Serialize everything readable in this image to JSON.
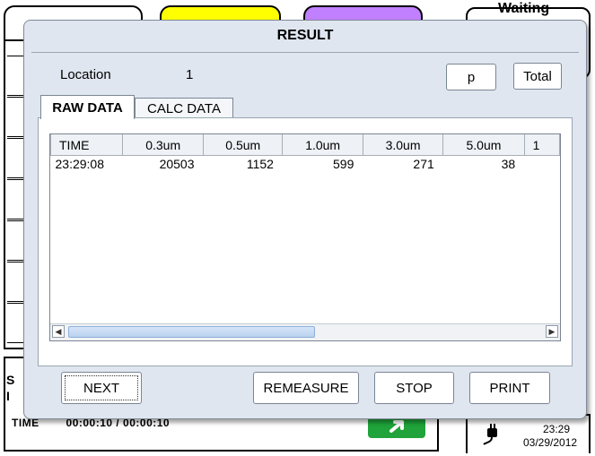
{
  "background": {
    "status_time_label": "TIME",
    "status_time_value": "00:00:10 / 00:00:10",
    "status_letter_top": "S",
    "status_letter_bottom": "I",
    "clock_time": "23:29",
    "clock_date": "03/29/2012",
    "waiting_text": "Waiting",
    "tab_colors": [
      "#ffffff",
      "#ffff00",
      "#c080ff"
    ]
  },
  "dialog": {
    "title": "RESULT",
    "location_label": "Location",
    "location_value": "1",
    "p_button": "p",
    "total_button": "Total",
    "tabs": [
      {
        "label": "RAW DATA",
        "active": true
      },
      {
        "label": "CALC DATA",
        "active": false
      }
    ],
    "table": {
      "headers": [
        "TIME",
        "0.3um",
        "0.5um",
        "1.0um",
        "3.0um",
        "5.0um",
        "1"
      ],
      "rows": [
        [
          "23:29:08",
          "20503",
          "1152",
          "599",
          "271",
          "38",
          ""
        ]
      ]
    },
    "buttons": {
      "next": "NEXT",
      "remeasure": "REMEASURE",
      "stop": "STOP",
      "print": "PRINT"
    }
  }
}
